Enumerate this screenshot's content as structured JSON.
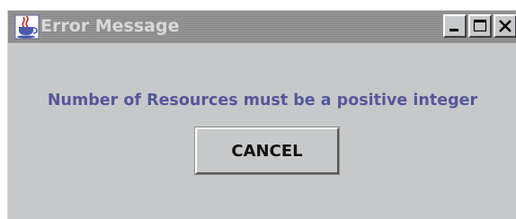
{
  "window": {
    "title": "Error Message",
    "app_icon": "java-cup-icon",
    "controls": {
      "minimize_icon": "minimize-icon",
      "maximize_icon": "maximize-icon",
      "close_icon": "close-icon"
    }
  },
  "dialog": {
    "message": "Number of Resources must be a positive integer",
    "cancel_label": "CANCEL"
  },
  "colors": {
    "message": "#55579a",
    "background": "#c7c8c9",
    "titlebar": "#8e8e8e"
  }
}
